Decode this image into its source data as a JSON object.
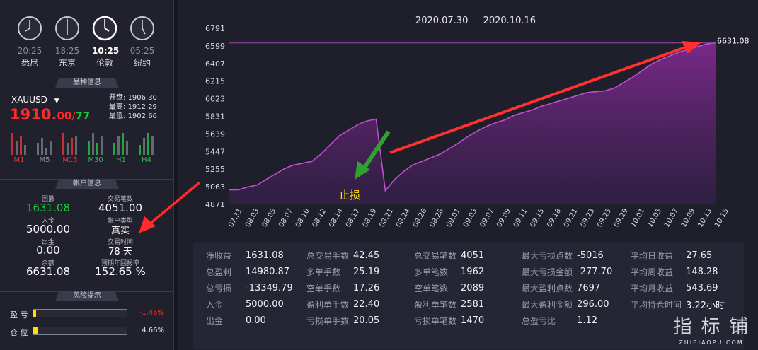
{
  "clocks": [
    {
      "time": "20:25",
      "city": "悉尼",
      "active": false
    },
    {
      "time": "18:25",
      "city": "东京",
      "active": false
    },
    {
      "time": "10:25",
      "city": "伦敦",
      "active": true
    },
    {
      "time": "05:25",
      "city": "纽约",
      "active": false
    }
  ],
  "sections": {
    "symbol_info": "品种信息",
    "account_info": "帐户信息",
    "risk": "风险提示"
  },
  "symbol": {
    "name": "XAUUSD",
    "price_big": "1910.",
    "price_small": "00",
    "slash": "/",
    "price_alt": "77",
    "open_label": "开盘:",
    "open": "1906.30",
    "high_label": "最高:",
    "high": "1912.29",
    "low_label": "最低:",
    "low": "1902.66",
    "timeframes": [
      "M1",
      "M5",
      "M15",
      "M30",
      "H1",
      "H4"
    ],
    "timeframe_colors": [
      "#e0333a",
      "#8c8c96",
      "#e0333a",
      "#20c040",
      "#20c040",
      "#20c040"
    ]
  },
  "account": {
    "drawdown_label": "回撤",
    "drawdown": "1631.08",
    "trades_label": "交易笔数",
    "trades": "4051.00",
    "deposit_label": "入金",
    "deposit": "5000.00",
    "type_label": "帐户类型",
    "type": "真实",
    "withdraw_label": "出金",
    "withdraw": "0.00",
    "days_label": "交易时间",
    "days": "78 天",
    "balance_label": "余额",
    "balance": "6631.08",
    "annual_label": "预期年回报率",
    "annual": "152.65 %"
  },
  "risk": {
    "pl_label": "盈 亏",
    "pl_value": "-1.46%",
    "pl_fraction": 0.03,
    "pos_label": "仓 位",
    "pos_value": "4.66%",
    "pos_fraction": 0.05
  },
  "chart_data": {
    "type": "area",
    "title": "2020.07.30 — 2020.10.16",
    "yticks": [
      "6791",
      "6599",
      "6407",
      "6215",
      "6023",
      "5831",
      "5639",
      "5447",
      "5255",
      "5063",
      "4871"
    ],
    "ylim": [
      4871,
      6791
    ],
    "xticks": [
      "07.31",
      "08.03",
      "08.05",
      "08.07",
      "08.10",
      "08.12",
      "08.14",
      "08.17",
      "08.19",
      "08.21",
      "08.24",
      "08.26",
      "08.28",
      "09.01",
      "09.03",
      "09.07",
      "09.09",
      "09.11",
      "09.15",
      "09.18",
      "09.21",
      "09.23",
      "09.25",
      "09.29",
      "10.01",
      "10.05",
      "10.07",
      "10.09",
      "10.13",
      "10.15"
    ],
    "values": [
      5030,
      5030,
      5060,
      5080,
      5140,
      5200,
      5260,
      5300,
      5320,
      5340,
      5420,
      5520,
      5620,
      5680,
      5740,
      5780,
      5800,
      5020,
      5140,
      5230,
      5300,
      5340,
      5380,
      5420,
      5480,
      5540,
      5610,
      5670,
      5720,
      5760,
      5790,
      5840,
      5870,
      5900,
      5940,
      5970,
      6000,
      6030,
      6060,
      6090,
      6100,
      6110,
      6140,
      6200,
      6260,
      6330,
      6400,
      6450,
      6490,
      6530,
      6560,
      6590,
      6620,
      6631.08
    ],
    "end_label": "6631.08",
    "annotation": "止损"
  },
  "stats": [
    [
      [
        "净收益",
        "1631.08"
      ],
      [
        "总交易手数",
        "42.45"
      ],
      [
        "总交易笔数",
        "4051"
      ],
      [
        "最大亏损点数",
        "-5016"
      ],
      [
        "平均日收益",
        "27.65"
      ]
    ],
    [
      [
        "总盈利",
        "14980.87"
      ],
      [
        "多单手数",
        "25.19"
      ],
      [
        "多单笔数",
        "1962"
      ],
      [
        "最大亏损金额",
        "-277.70"
      ],
      [
        "平均周收益",
        "148.28"
      ]
    ],
    [
      [
        "总亏损",
        "-13349.79"
      ],
      [
        "空单手数",
        "17.26"
      ],
      [
        "空单笔数",
        "2089"
      ],
      [
        "最大盈利点数",
        "7697"
      ],
      [
        "平均月收益",
        "543.69"
      ]
    ],
    [
      [
        "入金",
        "5000.00"
      ],
      [
        "盈利单手数",
        "22.40"
      ],
      [
        "盈利单笔数",
        "2581"
      ],
      [
        "最大盈利金额",
        "296.00"
      ],
      [
        "平均持仓时间",
        "3.22小时"
      ]
    ],
    [
      [
        "出金",
        "0.00"
      ],
      [
        "亏损单手数",
        "20.05"
      ],
      [
        "亏损单笔数",
        "1470"
      ],
      [
        "总盈亏比",
        "1.12"
      ],
      [
        "",
        ""
      ]
    ]
  ],
  "watermark": {
    "cn": "指 标 铺",
    "en": "ZHIBIAOPU.COM"
  }
}
